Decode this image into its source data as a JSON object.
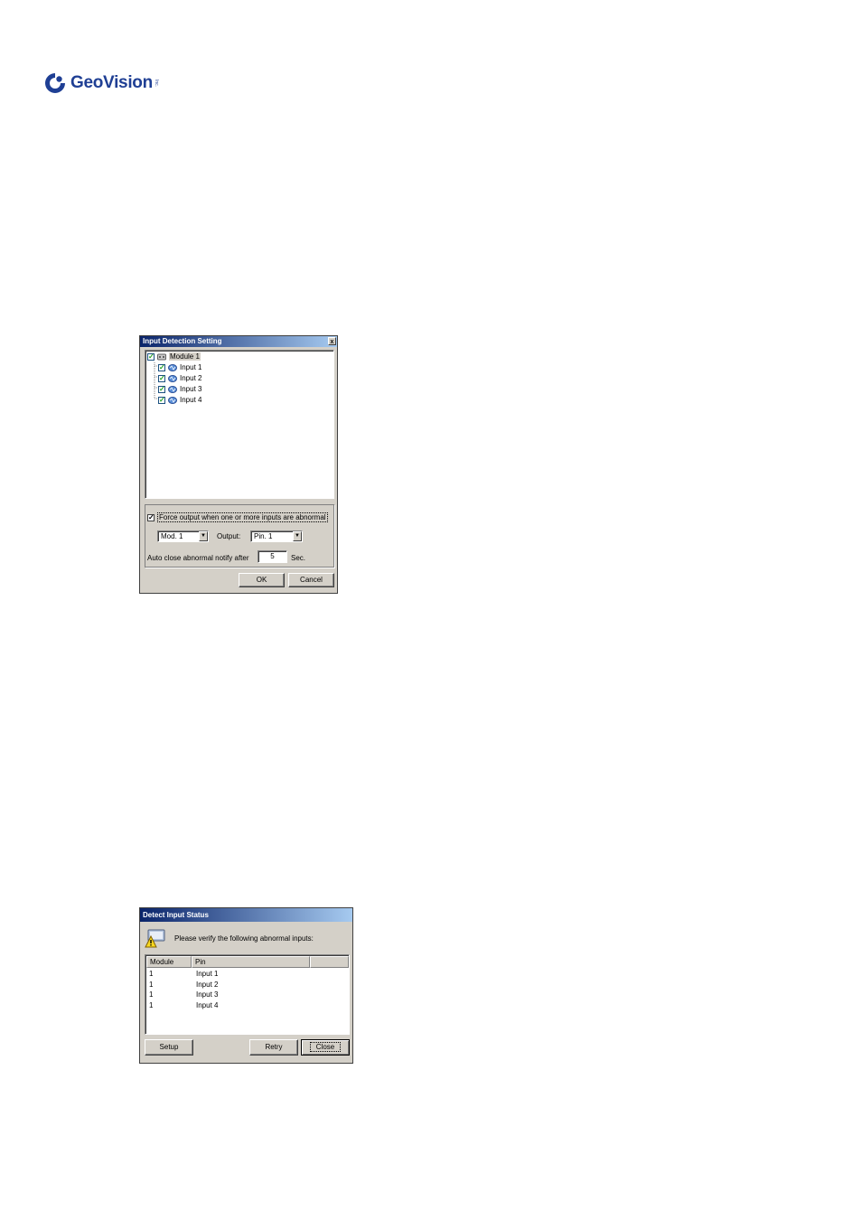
{
  "brand": {
    "name": "GeoVision",
    "suffix": "Inc."
  },
  "input_detection": {
    "title": "Input Detection Setting",
    "close_glyph": "x",
    "tree": {
      "module": "Module 1",
      "inputs": [
        "Input 1",
        "Input 2",
        "Input 3",
        "Input 4"
      ]
    },
    "force_output_label": "Force output when one or more inputs are abnormal",
    "module_select": "Mod. 1",
    "output_label": "Output:",
    "pin_select": "Pin. 1",
    "auto_close_label": "Auto close abnormal notify after",
    "auto_close_value": "5",
    "sec_label": "Sec.",
    "ok_label": "OK",
    "cancel_label": "Cancel"
  },
  "detect_status": {
    "title": "Detect Input Status",
    "message": "Please verify the following abnormal inputs:",
    "columns": [
      "Module",
      "Pin",
      ""
    ],
    "rows": [
      [
        "1",
        "Input 1"
      ],
      [
        "1",
        "Input 2"
      ],
      [
        "1",
        "Input 3"
      ],
      [
        "1",
        "Input 4"
      ]
    ],
    "setup_label": "Setup",
    "retry_label": "Retry",
    "close_label": "Close"
  }
}
